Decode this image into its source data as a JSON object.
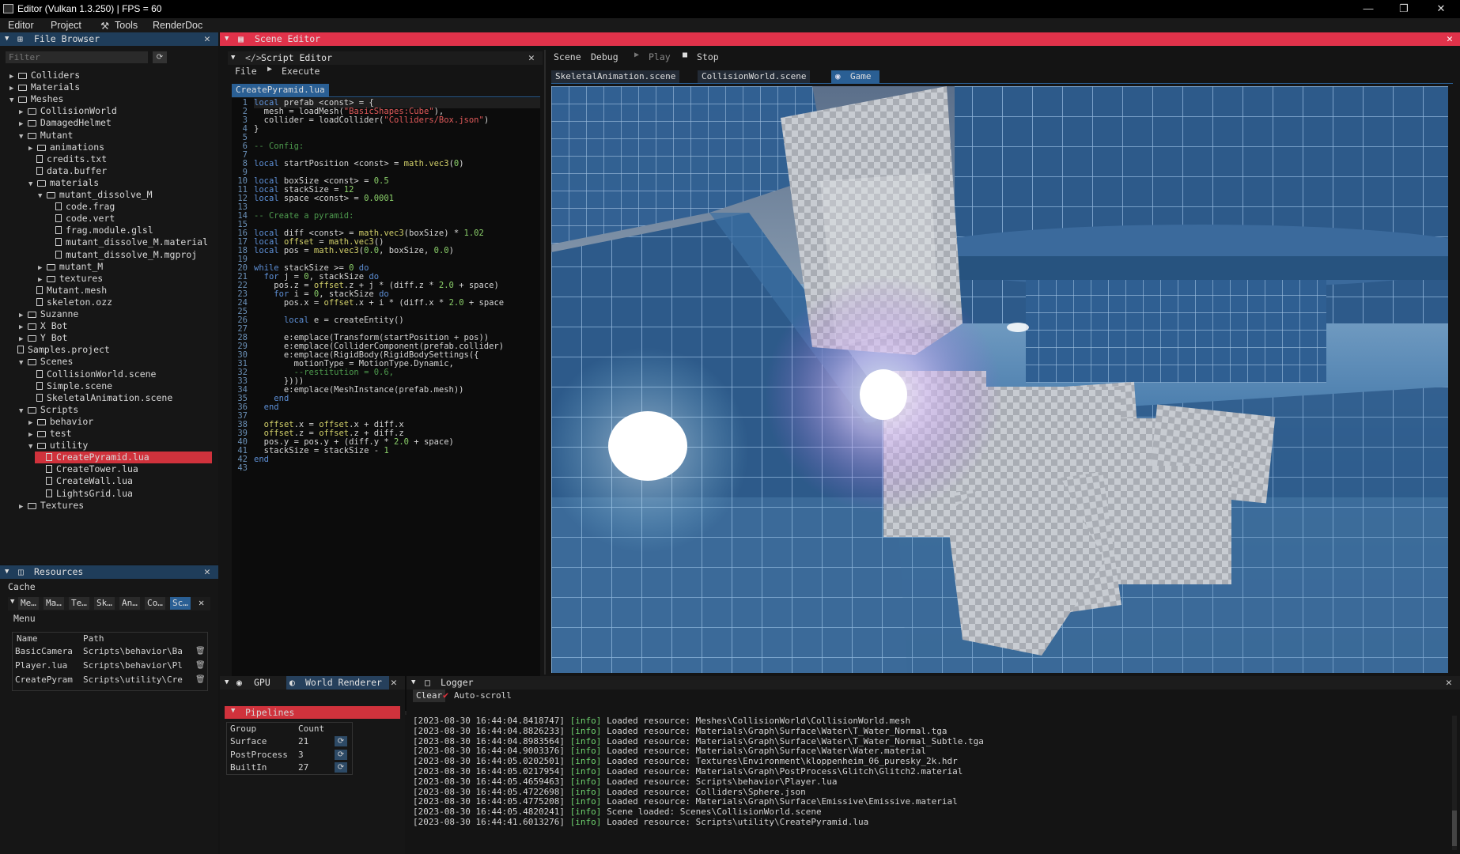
{
  "window": {
    "title": "Editor (Vulkan 1.3.250) | FPS = 60"
  },
  "menu": [
    "Editor",
    "Project",
    "Tools",
    "RenderDoc"
  ],
  "file_browser": {
    "title": "File Browser",
    "filter_placeholder": "Filter",
    "items": [
      {
        "label": "Colliders",
        "type": "folder",
        "state": "closed"
      },
      {
        "label": "Materials",
        "type": "folder",
        "state": "closed"
      },
      {
        "label": "Meshes",
        "type": "folder",
        "state": "open"
      },
      {
        "label": "CollisionWorld",
        "type": "folder",
        "state": "closed"
      },
      {
        "label": "DamagedHelmet",
        "type": "folder",
        "state": "closed"
      },
      {
        "label": "Mutant",
        "type": "folder",
        "state": "open"
      },
      {
        "label": "animations",
        "type": "folder",
        "state": "closed"
      },
      {
        "label": "credits.txt",
        "type": "file"
      },
      {
        "label": "data.buffer",
        "type": "file"
      },
      {
        "label": "materials",
        "type": "folder",
        "state": "open"
      },
      {
        "label": "mutant_dissolve_M",
        "type": "folder",
        "state": "open"
      },
      {
        "label": "code.frag",
        "type": "file"
      },
      {
        "label": "code.vert",
        "type": "file"
      },
      {
        "label": "frag.module.glsl",
        "type": "file"
      },
      {
        "label": "mutant_dissolve_M.material",
        "type": "file"
      },
      {
        "label": "mutant_dissolve_M.mgproj",
        "type": "file"
      },
      {
        "label": "mutant_M",
        "type": "folder",
        "state": "closed"
      },
      {
        "label": "textures",
        "type": "folder",
        "state": "closed"
      },
      {
        "label": "Mutant.mesh",
        "type": "file"
      },
      {
        "label": "skeleton.ozz",
        "type": "file"
      },
      {
        "label": "Suzanne",
        "type": "folder",
        "state": "closed"
      },
      {
        "label": "X Bot",
        "type": "folder",
        "state": "closed"
      },
      {
        "label": "Y Bot",
        "type": "folder",
        "state": "closed"
      },
      {
        "label": "Samples.project",
        "type": "file"
      },
      {
        "label": "Scenes",
        "type": "folder",
        "state": "open"
      },
      {
        "label": "CollisionWorld.scene",
        "type": "file"
      },
      {
        "label": "Simple.scene",
        "type": "file"
      },
      {
        "label": "SkeletalAnimation.scene",
        "type": "file"
      },
      {
        "label": "Scripts",
        "type": "folder",
        "state": "open"
      },
      {
        "label": "behavior",
        "type": "folder",
        "state": "closed"
      },
      {
        "label": "test",
        "type": "folder",
        "state": "closed"
      },
      {
        "label": "utility",
        "type": "folder",
        "state": "open"
      },
      {
        "label": "CreatePyramid.lua",
        "type": "file",
        "selected": true
      },
      {
        "label": "CreateTower.lua",
        "type": "file"
      },
      {
        "label": "CreateWall.lua",
        "type": "file"
      },
      {
        "label": "LightsGrid.lua",
        "type": "file"
      },
      {
        "label": "Textures",
        "type": "folder",
        "state": "closed"
      }
    ]
  },
  "resources": {
    "title": "Resources",
    "cache_label": "Cache",
    "tabs": [
      "Me…",
      "Ma…",
      "Te…",
      "Sk…",
      "An…",
      "Co…",
      "Sc…"
    ],
    "menu_label": "Menu",
    "columns": [
      "Name",
      "Path"
    ],
    "rows": [
      {
        "name": "BasicCamera",
        "path": "Scripts\\behavior\\Ba"
      },
      {
        "name": "Player.lua",
        "path": "Scripts\\behavior\\Pl"
      },
      {
        "name": "CreatePyram",
        "path": "Scripts\\utility\\Cre"
      }
    ]
  },
  "scene_editor": {
    "title": "Scene Editor"
  },
  "script_editor": {
    "title": "Script Editor",
    "menu": [
      "File",
      "Execute"
    ],
    "tab": "CreatePyramid.lua",
    "lines": [
      "local prefab <const> = {",
      "  mesh = loadMesh(\"BasicShapes:Cube\"),",
      "  collider = loadCollider(\"Colliders/Box.json\")",
      "}",
      "",
      "-- Config:",
      "",
      "local startPosition <const> = math.vec3(0)",
      "",
      "local boxSize <const> = 0.5",
      "local stackSize = 12",
      "local space <const> = 0.0001",
      "",
      "-- Create a pyramid:",
      "",
      "local diff <const> = math.vec3(boxSize) * 1.02",
      "local offset = math.vec3()",
      "local pos = math.vec3(0.0, boxSize, 0.0)",
      "",
      "while stackSize >= 0 do",
      "  for j = 0, stackSize do",
      "    pos.z = offset.z + j * (diff.z * 2.0 + space)",
      "    for i = 0, stackSize do",
      "      pos.x = offset.x + i * (diff.x * 2.0 + space",
      "",
      "      local e = createEntity()",
      "",
      "      e:emplace(Transform(startPosition + pos))",
      "      e:emplace(ColliderComponent(prefab.collider)",
      "      e:emplace(RigidBody(RigidBodySettings({",
      "        motionType = MotionType.Dynamic,",
      "        --restitution = 0.6,",
      "      })))",
      "      e:emplace(MeshInstance(prefab.mesh))",
      "    end",
      "  end",
      "",
      "  offset.x = offset.x + diff.x",
      "  offset.z = offset.z + diff.z",
      "  pos.y = pos.y + (diff.y * 2.0 + space)",
      "  stackSize = stackSize - 1",
      "end",
      ""
    ]
  },
  "scene_view": {
    "menu": [
      "Scene",
      "Debug",
      "Play",
      "Stop"
    ],
    "tabs": [
      "SkeletalAnimation.scene",
      "CollisionWorld.scene",
      "Game"
    ]
  },
  "gpu_panel": {
    "tabs": [
      "GPU",
      "World Renderer"
    ],
    "pipelines_label": "Pipelines",
    "columns": [
      "Group",
      "Count"
    ],
    "rows": [
      {
        "group": "Surface",
        "count": "21"
      },
      {
        "group": "PostProcess",
        "count": "3"
      },
      {
        "group": "BuiltIn",
        "count": "27"
      }
    ]
  },
  "logger": {
    "title": "Logger",
    "clear_label": "Clear",
    "autoscroll_label": "Auto-scroll",
    "entries": [
      {
        "ts": "[2023-08-30 16:44:04.8418747]",
        "level": "[info]",
        "msg": "Loaded resource: Meshes\\CollisionWorld\\CollisionWorld.mesh"
      },
      {
        "ts": "[2023-08-30 16:44:04.8826233]",
        "level": "[info]",
        "msg": "Loaded resource: Materials\\Graph\\Surface\\Water\\T_Water_Normal.tga"
      },
      {
        "ts": "[2023-08-30 16:44:04.8983564]",
        "level": "[info]",
        "msg": "Loaded resource: Materials\\Graph\\Surface\\Water\\T_Water_Normal_Subtle.tga"
      },
      {
        "ts": "[2023-08-30 16:44:04.9003376]",
        "level": "[info]",
        "msg": "Loaded resource: Materials\\Graph\\Surface\\Water\\Water.material"
      },
      {
        "ts": "[2023-08-30 16:44:05.0202501]",
        "level": "[info]",
        "msg": "Loaded resource: Textures\\Environment\\kloppenheim_06_puresky_2k.hdr"
      },
      {
        "ts": "[2023-08-30 16:44:05.0217954]",
        "level": "[info]",
        "msg": "Loaded resource: Materials\\Graph\\PostProcess\\Glitch\\Glitch2.material"
      },
      {
        "ts": "[2023-08-30 16:44:05.4659463]",
        "level": "[info]",
        "msg": "Loaded resource: Scripts\\behavior\\Player.lua"
      },
      {
        "ts": "[2023-08-30 16:44:05.4722698]",
        "level": "[info]",
        "msg": "Loaded resource: Colliders\\Sphere.json"
      },
      {
        "ts": "[2023-08-30 16:44:05.4775208]",
        "level": "[info]",
        "msg": "Loaded resource: Materials\\Graph\\Surface\\Emissive\\Emissive.material"
      },
      {
        "ts": "[2023-08-30 16:44:05.4820241]",
        "level": "[info]",
        "msg": "Scene loaded: Scenes\\CollisionWorld.scene"
      },
      {
        "ts": "[2023-08-30 16:44:41.6013276]",
        "level": "[info]",
        "msg": "Loaded resource: Scripts\\utility\\CreatePyramid.lua"
      }
    ]
  }
}
